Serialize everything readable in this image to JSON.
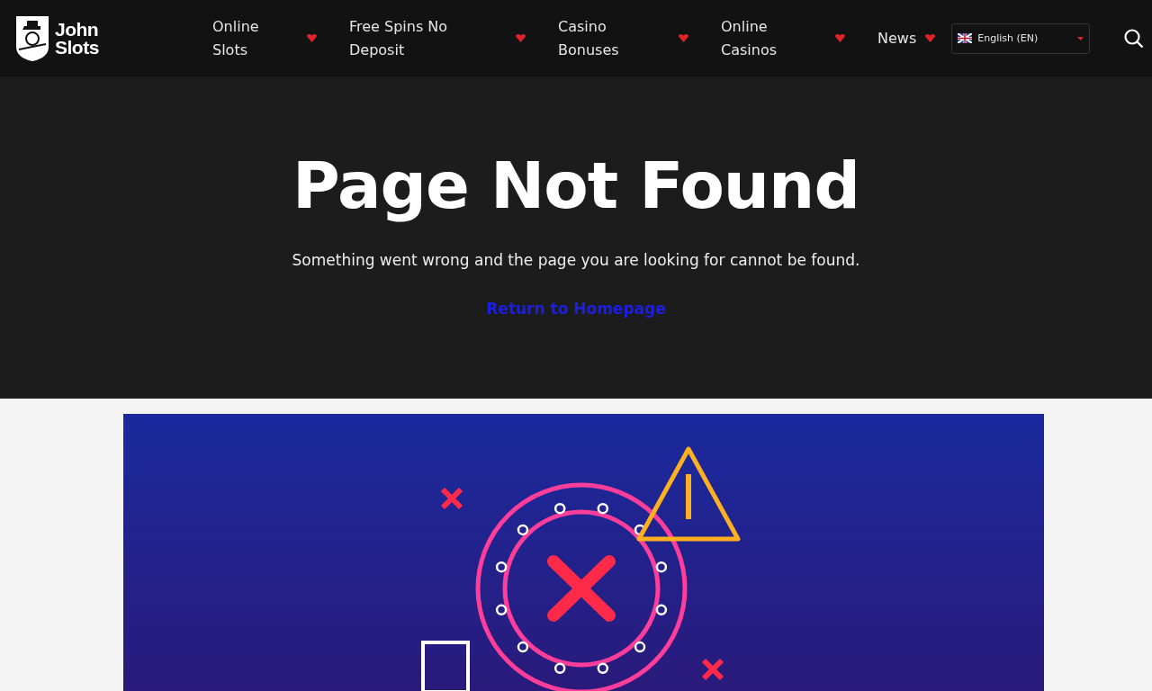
{
  "logo": {
    "line1": "John",
    "line2": "Slots"
  },
  "nav": [
    {
      "label": "Online Slots"
    },
    {
      "label": "Free Spins No Deposit"
    },
    {
      "label": "Casino Bonuses"
    },
    {
      "label": "Online Casinos"
    },
    {
      "label": "News"
    }
  ],
  "language": {
    "value": "English (EN)"
  },
  "hero": {
    "title": "Page Not Found",
    "message": "Something went wrong and the page you are looking for cannot be found.",
    "link": "Return to Homepage"
  }
}
